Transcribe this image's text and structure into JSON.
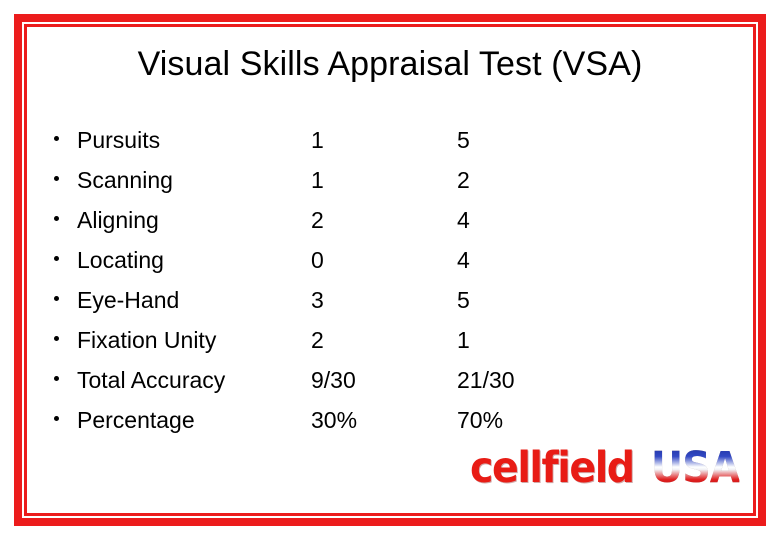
{
  "slide": {
    "title": "Visual Skills Appraisal Test (VSA)",
    "frame_color": "#ec1c1c",
    "background_color": "#ffffff"
  },
  "table": {
    "bullet": "•",
    "rows": [
      {
        "label": "Pursuits",
        "score_1": "1",
        "score_2": "5"
      },
      {
        "label": "Scanning",
        "score_1": "1",
        "score_2": "2"
      },
      {
        "label": "Aligning",
        "score_1": "2",
        "score_2": "4"
      },
      {
        "label": "Locating",
        "score_1": "0",
        "score_2": "4"
      },
      {
        "label": "Eye-Hand",
        "score_1": "3",
        "score_2": "5"
      },
      {
        "label": "Fixation Unity",
        "score_1": "2",
        "score_2": "1"
      },
      {
        "label": "Total Accuracy",
        "score_1": "9/30",
        "score_2": "21/30"
      },
      {
        "label": "Percentage",
        "score_1": "30%",
        "score_2": "70%"
      }
    ]
  },
  "logo": {
    "brand_name": "cellfield",
    "brand_suffix": "USA",
    "brand_color": "#e81c15",
    "suffix_gradient_top": "#1b2f9c",
    "suffix_gradient_bottom": "#b01010"
  }
}
